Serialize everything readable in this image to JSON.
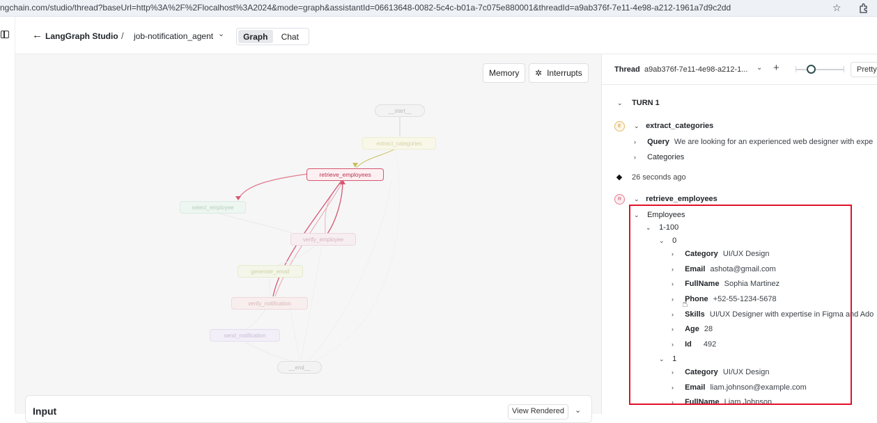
{
  "browser": {
    "url": "ngchain.com/studio/thread?baseUrl=http%3A%2F%2Flocalhost%3A2024&mode=graph&assistantId=06613648-0082-5c4c-b01a-7c075e880001&threadId=a9ab376f-7e11-4e98-a212-1961a7d9c2dd"
  },
  "header": {
    "brand": "LangGraph Studio",
    "separator": "/",
    "agent": "job-notification_agent",
    "tabs": [
      {
        "label": "Graph",
        "active": true
      },
      {
        "label": "Chat",
        "active": false
      }
    ]
  },
  "canvas": {
    "memory_label": "Memory",
    "interrupts_label": "Interrupts",
    "nodes": {
      "start": "__start__",
      "extract_categories": "extract_categories",
      "retrieve_employees": "retrieve_employees",
      "select_employee": "select_employee",
      "verify_employee": "verify_employee",
      "generate_email": "generate_email",
      "verify_notification": "verify_notification",
      "send_notification": "send_notification",
      "end": "__end__"
    },
    "input": {
      "title": "Input",
      "view_rendered_label": "View Rendered"
    }
  },
  "panel": {
    "thread_label": "Thread",
    "thread_id": "a9ab376f-7e11-4e98-a212-1...",
    "pretty_label": "Pretty",
    "turn_label": "TURN 1",
    "extract": {
      "badge": "E",
      "name": "extract_categories",
      "query_key": "Query",
      "query_value": "We are looking for an experienced web designer with expe",
      "categories_key": "Categories"
    },
    "timestamp": "26 seconds ago",
    "retrieve": {
      "badge": "R",
      "name": "retrieve_employees",
      "employees_key": "Employees",
      "range_key": "1-100",
      "items": [
        {
          "index": "0",
          "fields": [
            {
              "key": "Category",
              "value": "UI/UX Design"
            },
            {
              "key": "Email",
              "value": "ashota@gmail.com"
            },
            {
              "key": "FullName",
              "value": "Sophia Martinez"
            },
            {
              "key": "Phone",
              "value": "+52-55-1234-5678"
            },
            {
              "key": "Skills",
              "value": "UI/UX Designer with expertise in Figma and Ado"
            },
            {
              "key": "Age",
              "value": "28"
            },
            {
              "key": "Id",
              "value": "492"
            }
          ]
        },
        {
          "index": "1",
          "fields": [
            {
              "key": "Category",
              "value": "UI/UX Design"
            },
            {
              "key": "Email",
              "value": "liam.johnson@example.com"
            },
            {
              "key": "FullName",
              "value": "Liam Johnson"
            }
          ]
        }
      ]
    }
  }
}
